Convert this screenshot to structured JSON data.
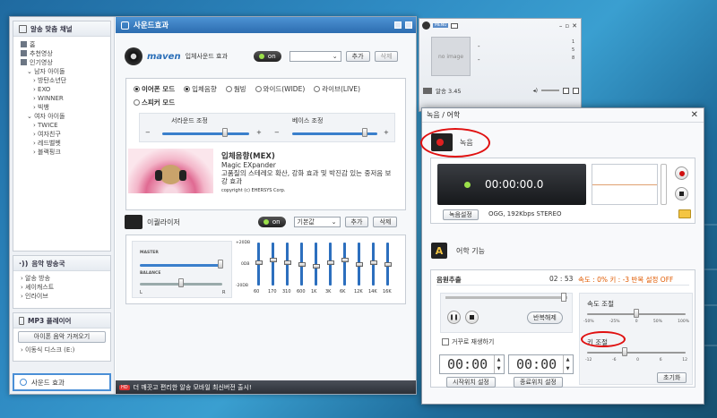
{
  "sidebar": {
    "channel_title": "알송 맞춤 채널",
    "items": [
      {
        "label": "홈",
        "level": 0
      },
      {
        "label": "추천영상",
        "level": 0
      },
      {
        "label": "인기영상",
        "level": 0
      },
      {
        "label": "남자 아이돌",
        "level": 1
      },
      {
        "label": "방탄소년단",
        "level": 2
      },
      {
        "label": "EXO",
        "level": 2
      },
      {
        "label": "WINNER",
        "level": 2
      },
      {
        "label": "빅뱅",
        "level": 2
      },
      {
        "label": "여자 아이돌",
        "level": 1
      },
      {
        "label": "TWICE",
        "level": 2
      },
      {
        "label": "여자친구",
        "level": 2
      },
      {
        "label": "레드벨벳",
        "level": 2
      },
      {
        "label": "블랙핑크",
        "level": 2
      }
    ],
    "broadcast_title": "음악 방송국",
    "broadcast_items": [
      "알송 방송",
      "셰이캐스트",
      "인라이브"
    ],
    "mp3_title": "MP3 플레이어",
    "mp3_button": "아이폰 음악 가져오기",
    "mp3_disk": "이동식 디스크 (E:)",
    "sound_effect": "사운드 효과"
  },
  "content": {
    "title": "사운드효과",
    "maven_brand": "maven",
    "maven_label": "입체사운드 효과",
    "on_label": "on",
    "add_button": "추가",
    "delete_button": "삭제",
    "modes_row1": [
      "이어폰 모드",
      "입체음향",
      "웜빙",
      "와이드(WIDE)",
      "라이브(LIVE)"
    ],
    "modes_row2": [
      "스피커 모드"
    ],
    "surround_label": "서라운드 조정",
    "bass_label": "베이스 조정",
    "minus": "−",
    "plus": "+",
    "mex_title": "입체음향(MEX)",
    "mex_subtitle": "Magic EXpander",
    "mex_desc": "고품질의 스테레오 확산, 강화 효과 및 박진감 있는 중저음 보강 효과",
    "copyright": "copyright (c) EHERSYS Corp.",
    "eq_label": "이퀄라이저",
    "eq_preset": "기본값",
    "eq_master": "MASTER",
    "eq_balance": "BALANCE",
    "eq_l": "L",
    "eq_r": "R",
    "eq_db": [
      "+20DB",
      "0DB",
      "-20DB"
    ],
    "eq_bands": [
      "60",
      "170",
      "310",
      "600",
      "1K",
      "3K",
      "6K",
      "12K",
      "14K",
      "16K"
    ],
    "eq_levels": [
      0.55,
      0.6,
      0.55,
      0.5,
      0.45,
      0.55,
      0.6,
      0.5,
      0.55,
      0.5
    ],
    "master_level": 0.98,
    "balance_level": 0.5,
    "surround_level": 0.72,
    "bass_level": 0.85
  },
  "status_bar": {
    "badge": "HD",
    "text": "더 깨끗고 편리한 알송 모바일 최신버전 출시!"
  },
  "player": {
    "menu_label": "MENU",
    "no_image": "no image",
    "volume_label": "알송 3.45",
    "dash": "-"
  },
  "record_dialog": {
    "title": "녹음 / 어학",
    "close": "✕",
    "rec_section": "녹음",
    "timer": "00:00:00.0",
    "settings_button": "녹음설정",
    "format": "OGG, 192Kbps STEREO",
    "lang_section": "어학 기능",
    "source_label": "음원추출",
    "position": "02 : 53",
    "speed_status": "속도 :  0%  키 : -3  반복 설정 OFF",
    "repeat_button": "반복해제",
    "reverse_label": "거꾸로 재생하기",
    "start_time": "00:00",
    "end_time": "00:00",
    "start_button": "시작위치 설정",
    "end_button": "종료위치 설정",
    "speed_label": "속도 조절",
    "speed_ticks": [
      "-50%",
      "-25%",
      "0",
      "50%",
      "100%"
    ],
    "speed_level": 0.5,
    "key_label": "키 조절",
    "key_ticks": [
      "-12",
      "-6",
      "0",
      "6",
      "12"
    ],
    "key_level": 0.38,
    "reset_button": "초기화"
  },
  "colors": {
    "accent_blue": "#2d6db0",
    "record_red": "#d01010",
    "status_orange": "#e05a00",
    "annotation_red": "#e01010"
  }
}
